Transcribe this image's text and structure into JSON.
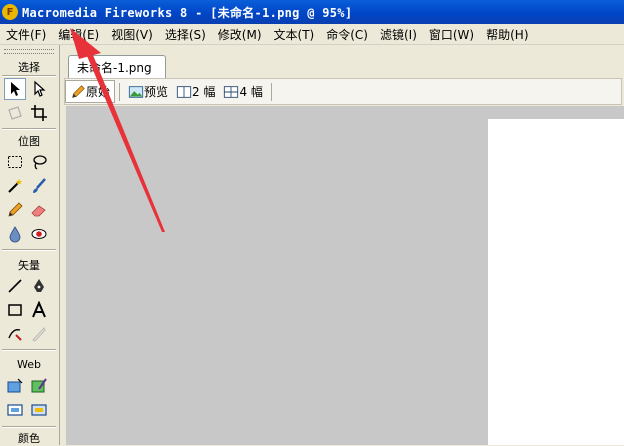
{
  "titlebar": {
    "app_icon_letter": "F",
    "title": "Macromedia Fireworks 8 - [未命名-1.png @ 95%]"
  },
  "menu": [
    {
      "label": "文件(F)"
    },
    {
      "label": "编辑(E)"
    },
    {
      "label": "视图(V)"
    },
    {
      "label": "选择(S)"
    },
    {
      "label": "修改(M)"
    },
    {
      "label": "文本(T)"
    },
    {
      "label": "命令(C)"
    },
    {
      "label": "滤镜(I)"
    },
    {
      "label": "窗口(W)"
    },
    {
      "label": "帮助(H)"
    }
  ],
  "tools": {
    "sections": {
      "select": "选择",
      "bitmap": "位图",
      "vector": "矢量",
      "web": "Web",
      "color": "颜色"
    }
  },
  "document": {
    "tab_label": "未命名-1.png",
    "views": {
      "original": "原始",
      "preview": "预览",
      "two_up": "2 幅",
      "four_up": "4 幅"
    }
  },
  "colors": {
    "annotation_arrow": "#e8323a",
    "canvas_bg": "#c8c8c8",
    "titlebar": "#0046c8"
  }
}
